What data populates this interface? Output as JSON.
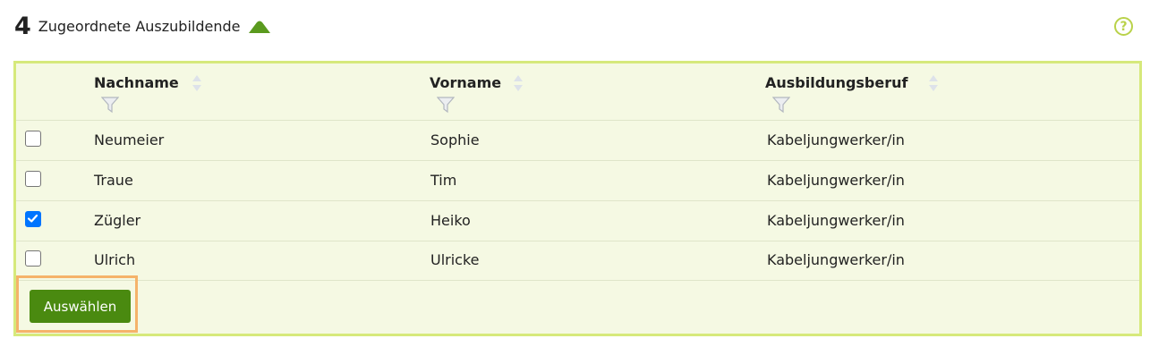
{
  "header": {
    "count": "4",
    "title": "Zugeordnete Auszubildende",
    "help_glyph": "?"
  },
  "table": {
    "columns": [
      {
        "label": "Nachname"
      },
      {
        "label": "Vorname"
      },
      {
        "label": "Ausbildungsberuf"
      }
    ],
    "rows": [
      {
        "nachname": "Neumeier",
        "vorname": "Sophie",
        "beruf": "Kabeljungwerker/in",
        "checked": false
      },
      {
        "nachname": "Traue",
        "vorname": "Tim",
        "beruf": "Kabeljungwerker/in",
        "checked": false
      },
      {
        "nachname": "Zügler",
        "vorname": "Heiko",
        "beruf": "Kabeljungwerker/in",
        "checked": true
      },
      {
        "nachname": "Ulrich",
        "vorname": "Ulricke",
        "beruf": "Kabeljungwerker/in",
        "checked": false
      }
    ]
  },
  "actions": {
    "select_label": "Auswählen"
  },
  "icons": {
    "collapse": "triangle-up-icon",
    "help": "question-circle-icon",
    "sort": "sort-arrows-icon",
    "filter": "funnel-icon"
  },
  "colors": {
    "accent_green": "#5a9a1e",
    "button_green": "#4a8a10",
    "panel_border": "#d6e97b",
    "panel_bg": "#f5f9e3",
    "focus_orange": "#f5b36a",
    "help_lime": "#b9d24a",
    "checkbox_blue": "#0075ff"
  }
}
